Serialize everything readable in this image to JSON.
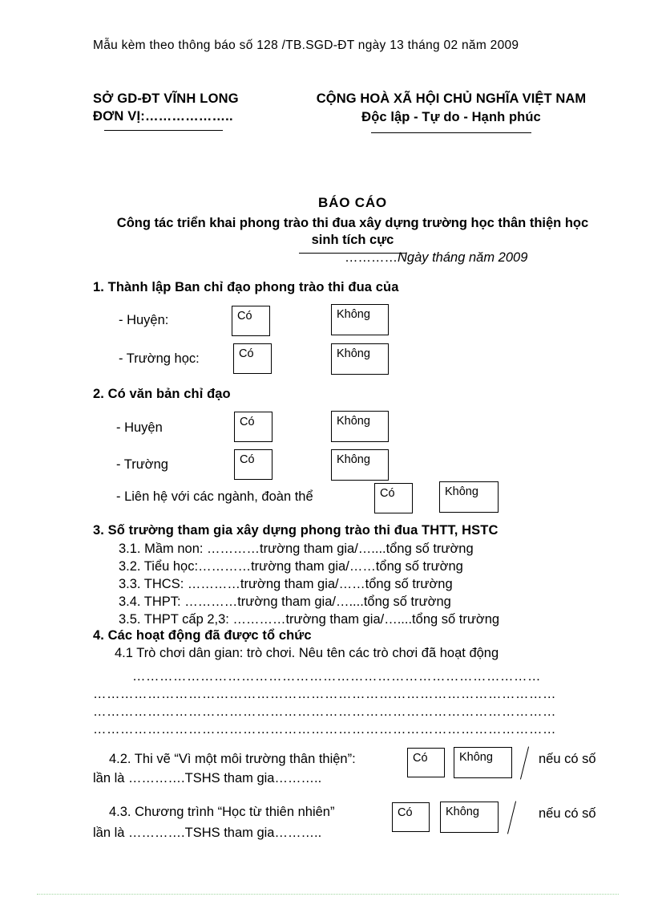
{
  "memo": {
    "line": "Mẫu kèm theo thông báo số 128   /TB.SGD-ĐT  ngày 13  tháng 02 năm 2009"
  },
  "letterhead": {
    "left_line1": "SỞ GD-ĐT VĨNH LONG",
    "left_line2": "ĐƠN VỊ:………………..",
    "right_line1": "CỘNG HOÀ XÃ HỘI CHỦ NGHĨA VIỆT NAM",
    "right_line2": "Độc lập - Tự do - Hạnh phúc",
    "date_dots": "…………",
    "date_text": "Ngày   tháng    năm 2009"
  },
  "title": {
    "main": "BÁO CÁO",
    "sub": "Công tác triển khai phong trào thi đua xây dựng trường học thân thiện học sinh tích cực"
  },
  "choices": {
    "yes": "Có",
    "no": "Không"
  },
  "section1": {
    "heading": "1. Thành lập Ban chỉ đạo phong trào thi đua của",
    "rows": [
      {
        "label": "- Huyện:"
      },
      {
        "label": "- Trường học:"
      }
    ]
  },
  "section2": {
    "heading": "2. Có văn bản chỉ đạo",
    "rows": [
      {
        "label": "- Huyện"
      },
      {
        "label": "- Trường"
      },
      {
        "label": "-    Liên hệ với các ngành,  đoàn thể"
      }
    ]
  },
  "section3": {
    "heading": "3. Số trường tham gia xây dựng phong trào thi đua THTT, HSTC",
    "items": [
      "3.1. Mầm non: …………trường tham gia/…....tổng số trường",
      "3.2. Tiểu học:…………trường tham gia/……tổng số trường",
      "3.3. THCS: …………trường tham gia/……tổng số trường",
      "3.4. THPT: …………trường tham gia/…....tổng số trường",
      "3.5. THPT cấp 2,3: …………trường tham gia/…....tổng số trường"
    ]
  },
  "section4": {
    "heading": "4. Các hoạt động đã được tổ chức",
    "item41": "4.1 Trò chơi dân gian:   trò chơi. Nêu tên các trò chơi đã hoạt động",
    "blank_lines": [
      "………………………………………………………………………………",
      "…………………………………………………………………………………………",
      "…………………………………………………………………………………………",
      "…………………………………………………………………………………………"
    ],
    "item42": {
      "line1": "4.2. Thi vẽ “Vì một môi trường thân thiện”:",
      "suffix": "nếu có số",
      "line2": "lần là ………….TSHS tham gia……….."
    },
    "item43": {
      "line1": "4.3. Chương trình “Học từ thiên nhiên”",
      "suffix": "nếu có số",
      "line2": "lần là ………….TSHS tham gia……….."
    }
  }
}
